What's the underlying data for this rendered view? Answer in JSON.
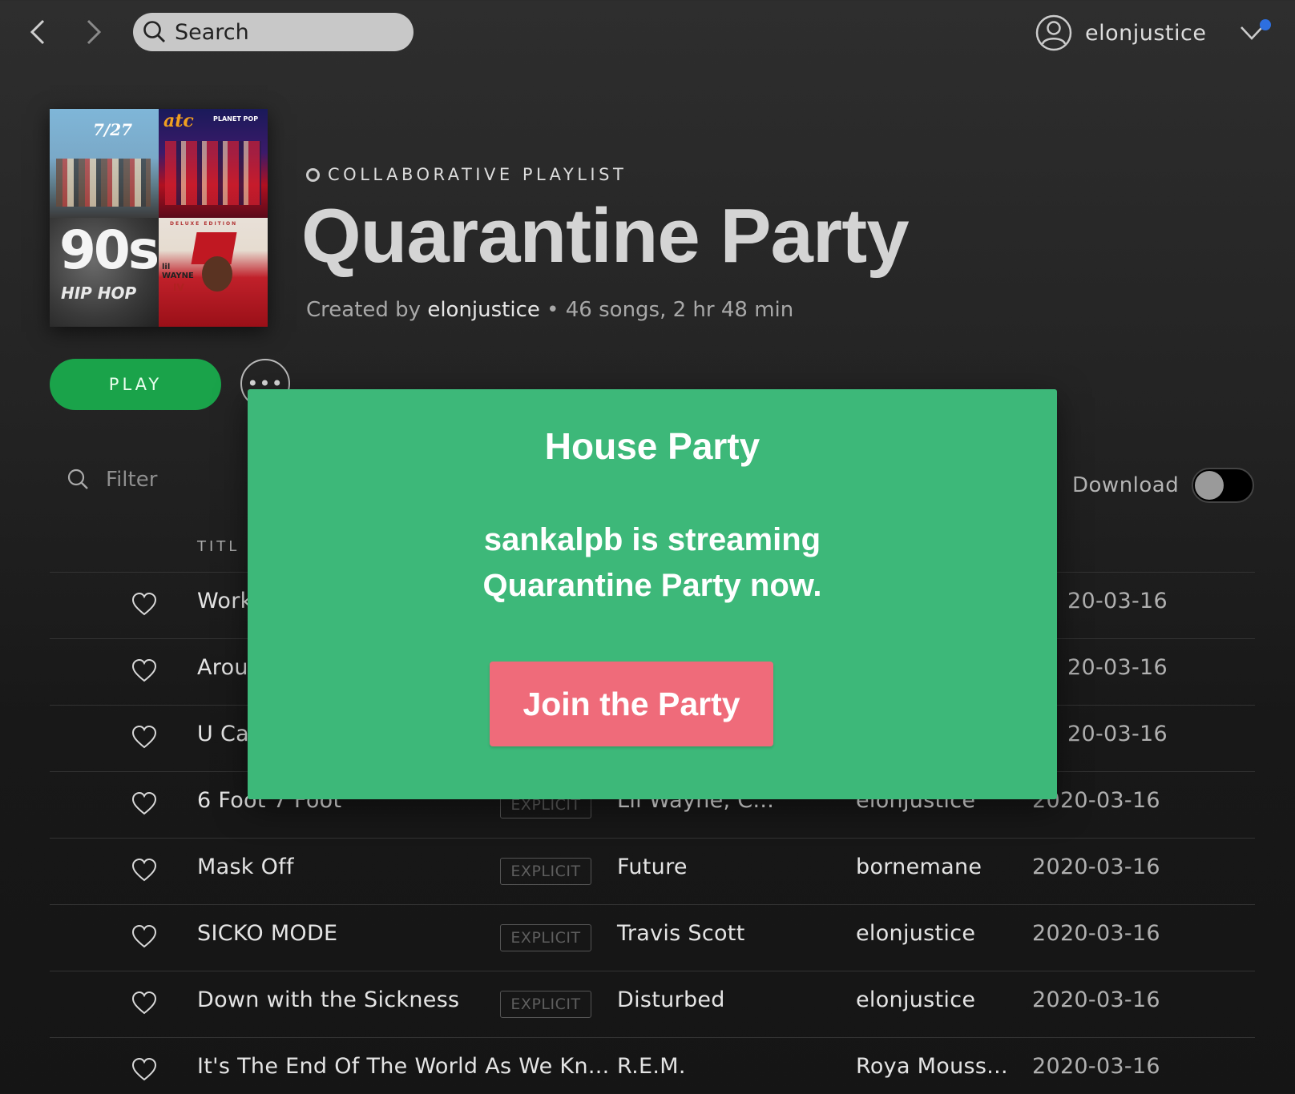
{
  "topbar": {
    "search_placeholder": "Search",
    "username": "elonjustice"
  },
  "playlist": {
    "type_label": "COLLABORATIVE PLAYLIST",
    "title": "Quarantine Party",
    "created_by_prefix": "Created by",
    "owner": "elonjustice",
    "separator": "•",
    "stats": "46 songs, 2 hr 48 min",
    "cover_tiles": {
      "tile1_text": "7/27",
      "tile2_text": "atc",
      "tile2_sub": "PLANET POP",
      "tile3_text": "90s",
      "tile3_sub": "HIP HOP",
      "tile4_text_top": "DELUXE EDITION",
      "tile4_text": "lil WAYNE",
      "tile4_sub": "IV"
    }
  },
  "actions": {
    "play_label": "PLAY",
    "more_label": "•••",
    "filter_placeholder": "Filter",
    "download_label": "Download",
    "download_on": false
  },
  "table": {
    "title_header": "TITL",
    "rows": [
      {
        "title": "Work",
        "explicit": "",
        "artist": "",
        "added_by": "",
        "date": "20-03-16"
      },
      {
        "title": "Arou",
        "explicit": "",
        "artist": "",
        "added_by": "",
        "date": "20-03-16"
      },
      {
        "title": "U Ca",
        "explicit": "",
        "artist": "",
        "added_by": "",
        "date": "20-03-16"
      },
      {
        "title": "6 Foot 7 Foot",
        "explicit": "EXPLICIT",
        "artist": "Lil Wayne, C...",
        "added_by": "elonjustice",
        "date": "2020-03-16"
      },
      {
        "title": "Mask Off",
        "explicit": "EXPLICIT",
        "artist": "Future",
        "added_by": "bornemane",
        "date": "2020-03-16"
      },
      {
        "title": "SICKO MODE",
        "explicit": "EXPLICIT",
        "artist": "Travis Scott",
        "added_by": "elonjustice",
        "date": "2020-03-16"
      },
      {
        "title": "Down with the Sickness",
        "explicit": "EXPLICIT",
        "artist": "Disturbed",
        "added_by": "elonjustice",
        "date": "2020-03-16"
      },
      {
        "title": "It's The End Of The World As We Kn...",
        "explicit": "",
        "artist": "R.E.M.",
        "added_by": "Roya Mouss...",
        "date": "2020-03-16"
      }
    ]
  },
  "modal": {
    "title": "House Party",
    "message_line1": "sankalpb is streaming",
    "message_line2": "Quarantine Party now.",
    "button_label": "Join the Party"
  },
  "colors": {
    "play_green": "#1aa34a",
    "modal_green": "#3db879",
    "join_button": "#ef6b7a",
    "notification_dot": "#2d6fe0"
  }
}
